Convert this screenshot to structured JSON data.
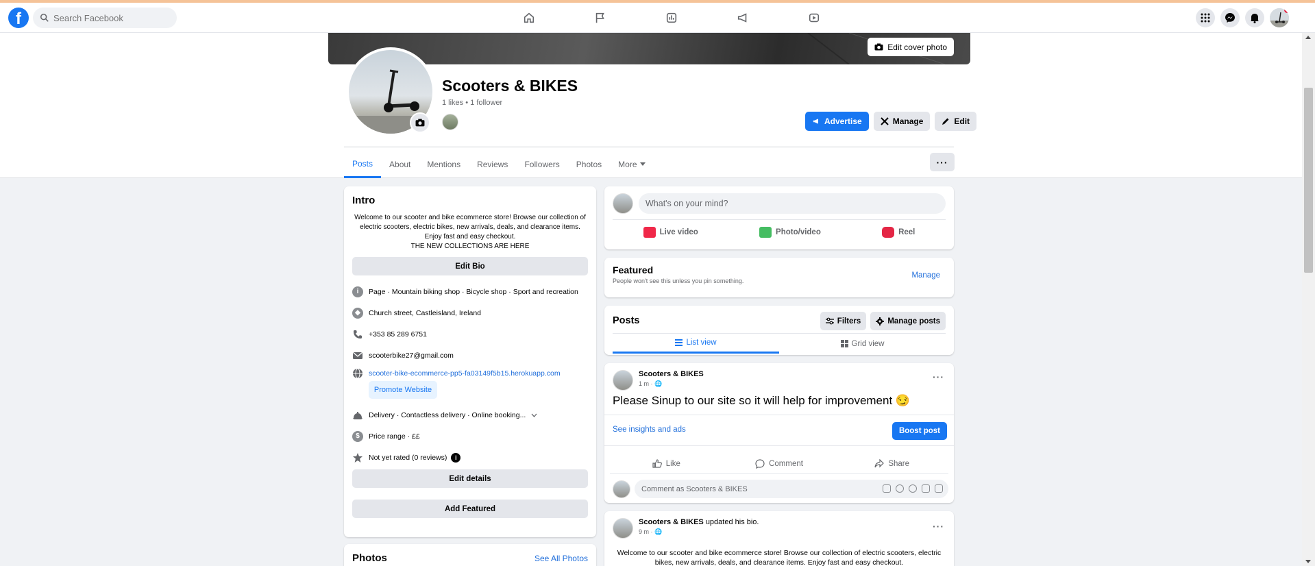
{
  "navbar": {
    "search_placeholder": "Search Facebook",
    "logo_letter": "f"
  },
  "cover": {
    "edit_label": "Edit cover photo"
  },
  "page": {
    "name": "Scooters & BIKES",
    "stats": "1 likes • 1 follower"
  },
  "actions": {
    "advertise": "Advertise",
    "manage": "Manage",
    "edit": "Edit"
  },
  "tabs": [
    "Posts",
    "About",
    "Mentions",
    "Reviews",
    "Followers",
    "Photos",
    "More"
  ],
  "more_dots": "···",
  "intro": {
    "title": "Intro",
    "bio": "Welcome to our scooter and bike ecommerce store! Browse our collection of electric scooters, electric bikes, new arrivals, deals, and clearance items. Enjoy fast and easy checkout.",
    "bio_line2": "THE NEW COLLECTIONS ARE HERE",
    "edit_bio": "Edit Bio",
    "category": "Page · Mountain biking shop · Bicycle shop · Sport and recreation",
    "address": "Church street, Castleisland, Ireland",
    "phone": "+353 85 289 6751",
    "email": "scooterbike27@gmail.com",
    "website": "scooter-bike-ecommerce-pp5-fa03149f5b15.herokuapp.com",
    "promote": "Promote Website",
    "services": "Delivery · Contactless delivery · Online booking...",
    "price": "Price range · ££",
    "rating": "Not yet rated (0 reviews)",
    "edit_details": "Edit details",
    "add_featured": "Add Featured"
  },
  "photos": {
    "title": "Photos",
    "see_all": "See All Photos"
  },
  "composer": {
    "placeholder": "What's on your mind?",
    "live": "Live video",
    "photo": "Photo/video",
    "reel": "Reel"
  },
  "featured": {
    "title": "Featured",
    "desc": "People won't see this unless you pin something.",
    "manage": "Manage"
  },
  "posts": {
    "title": "Posts",
    "filters": "Filters",
    "manage_posts": "Manage posts",
    "list_view": "List view",
    "grid_view": "Grid view"
  },
  "post1": {
    "author": "Scooters & BIKES",
    "time": "1 m ·",
    "text": "Please Sinup to our site so it will help for improvement 😏",
    "insights": "See insights and ads",
    "boost": "Boost post",
    "like": "Like",
    "comment": "Comment",
    "share": "Share",
    "comment_placeholder": "Comment as Scooters & BIKES"
  },
  "post2": {
    "author": "Scooters & BIKES",
    "action": "updated his bio.",
    "time": "9 m ·",
    "text": "Welcome to our scooter and bike ecommerce store! Browse our collection of electric scooters, electric bikes, new arrivals, deals, and clearance items. Enjoy fast and easy checkout."
  },
  "colors": {
    "accent": "#1877f2",
    "link": "#216fdb",
    "bg": "#f0f2f5"
  }
}
